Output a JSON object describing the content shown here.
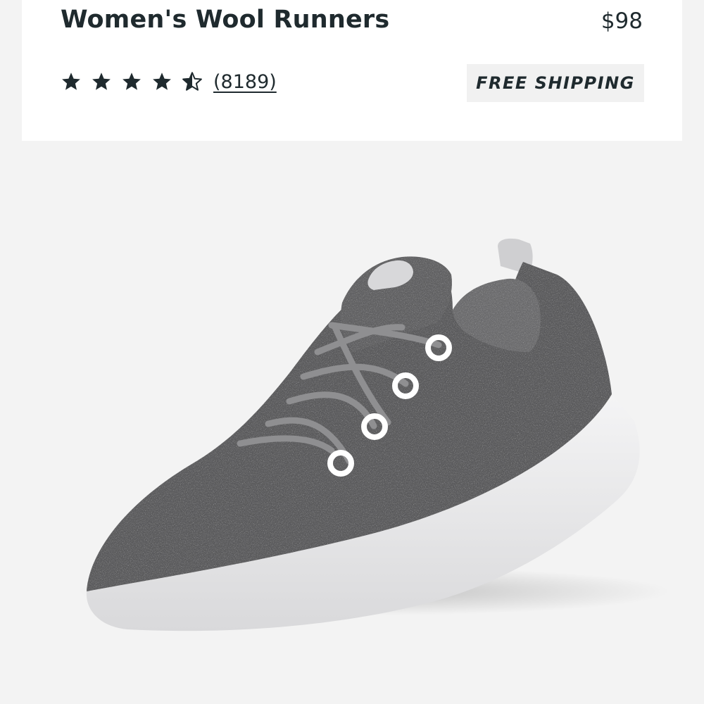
{
  "product": {
    "title": "Women's Wool Runners",
    "price": "$98",
    "rating": {
      "value": 4.5,
      "max": 5,
      "review_count": "(8189)"
    },
    "shipping_badge": "FREE SHIPPING"
  },
  "colors": {
    "text": "#1f2a2e",
    "badge_background": "#f1f1f1",
    "image_background": "#f3f3f3",
    "shoe_wool": "#5c5c5e",
    "shoe_sole": "#e9e9ea"
  },
  "icons": {
    "star_full": "star-icon",
    "star_half": "star-half-icon"
  }
}
